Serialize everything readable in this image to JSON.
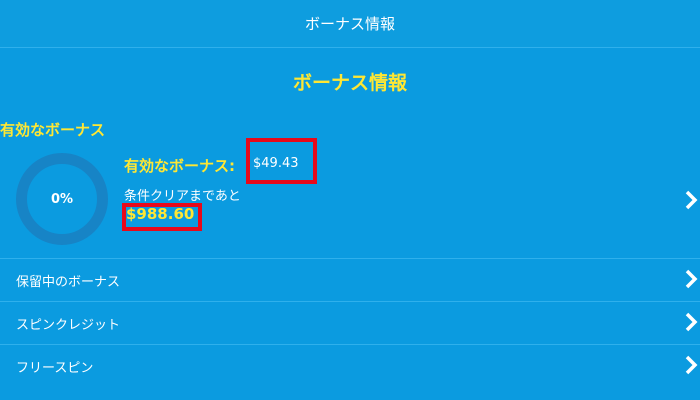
{
  "header": {
    "title": "ボーナス情報"
  },
  "page": {
    "title": "ボーナス情報"
  },
  "active_bonus": {
    "section_title": "有効なボーナス",
    "progress_percent_label": "0%",
    "progress_percent": 0,
    "label": "有効なボーナス:",
    "value": "$49.43",
    "remaining_label": "条件クリアまであと",
    "remaining_value": "$988.60"
  },
  "menu": {
    "items": [
      {
        "label": "保留中のボーナス"
      },
      {
        "label": "スピンクレジット"
      },
      {
        "label": "フリースピン"
      }
    ]
  },
  "colors": {
    "background": "#0b9be0",
    "accent_yellow": "#ffe733",
    "highlight_red": "#e8091a",
    "ring": "#1784c6"
  }
}
